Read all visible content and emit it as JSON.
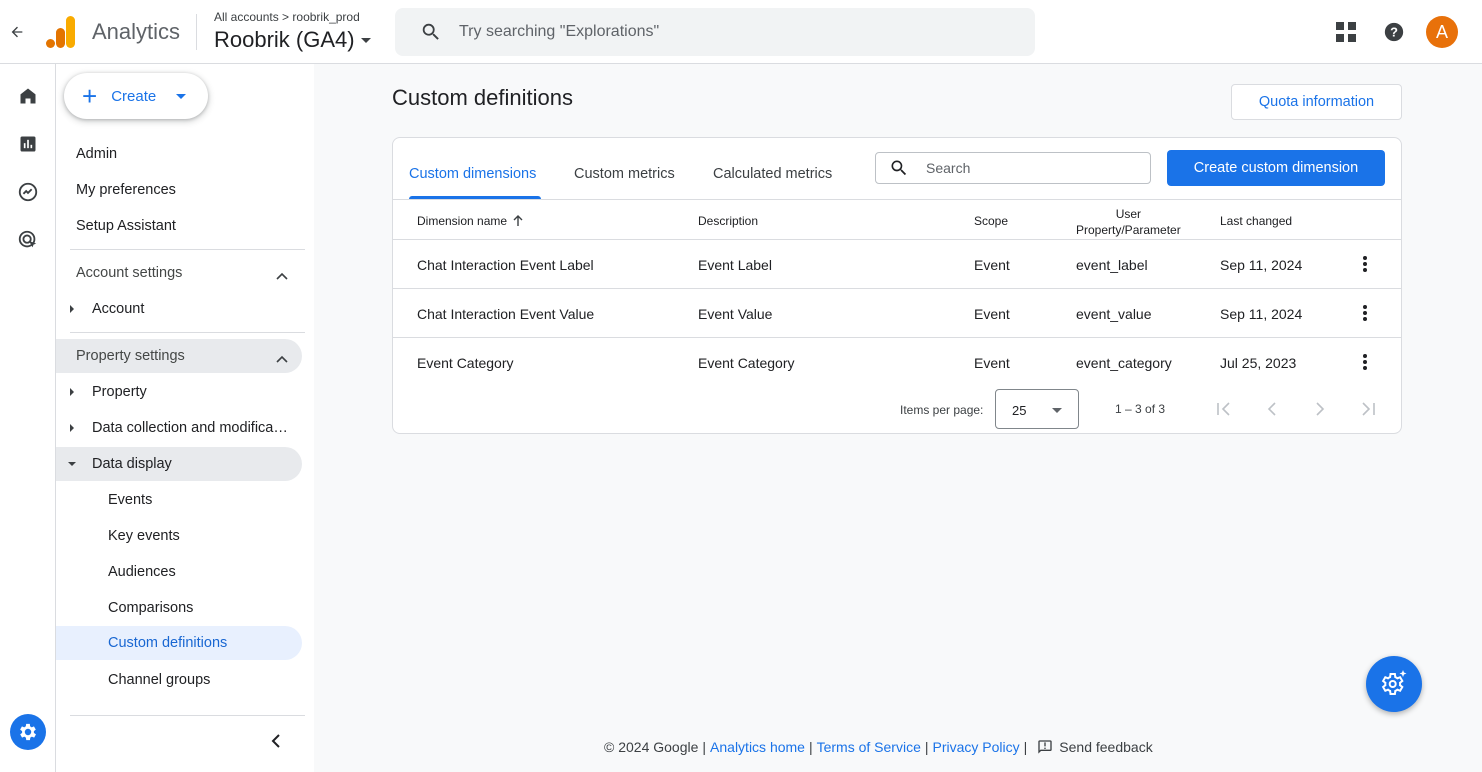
{
  "header": {
    "app_name": "Analytics",
    "breadcrumb_all": "All accounts",
    "breadcrumb_sep": ">",
    "breadcrumb_account": "roobrik_prod",
    "property_name": "Roobrik (GA4)",
    "search_placeholder": "Try searching \"Explorations\"",
    "avatar_letter": "A"
  },
  "nav": {
    "create_label": "Create",
    "top_items": [
      "Admin",
      "My preferences",
      "Setup Assistant"
    ],
    "account_settings": "Account settings",
    "account_item": "Account",
    "property_settings": "Property settings",
    "property_item": "Property",
    "data_collection_item": "Data collection and modifica…",
    "data_display_item": "Data display",
    "data_display_children": [
      "Events",
      "Key events",
      "Audiences",
      "Comparisons",
      "Custom definitions",
      "Channel groups"
    ],
    "active_item": "Custom definitions"
  },
  "main": {
    "title": "Custom definitions",
    "quota_button": "Quota information",
    "tabs": [
      "Custom dimensions",
      "Custom metrics",
      "Calculated metrics"
    ],
    "active_tab": "Custom dimensions",
    "search_placeholder": "Search",
    "create_button": "Create custom dimension",
    "columns": [
      "Dimension name",
      "Description",
      "Scope",
      "User",
      "Property/Parameter",
      "Last changed"
    ],
    "rows": [
      {
        "name": "Chat Interaction Event Label",
        "description": "Event Label",
        "scope": "Event",
        "param": "event_label",
        "changed": "Sep 11, 2024"
      },
      {
        "name": "Chat Interaction Event Value",
        "description": "Event Value",
        "scope": "Event",
        "param": "event_value",
        "changed": "Sep 11, 2024"
      },
      {
        "name": "Event Category",
        "description": "Event Category",
        "scope": "Event",
        "param": "event_category",
        "changed": "Jul 25, 2023"
      }
    ],
    "pager": {
      "items_per_page_label": "Items per page:",
      "items_per_page_value": "25",
      "range": "1 – 3 of 3"
    }
  },
  "footer": {
    "copyright": "© 2024 Google",
    "links": [
      "Analytics home",
      "Terms of Service",
      "Privacy Policy"
    ],
    "feedback": "Send feedback"
  },
  "colors": {
    "accent": "#1a73e8",
    "active_nav_bg": "#e8f0fe",
    "avatar": "#e8710a",
    "logo_orange": "#f9ab00",
    "logo_dark_orange": "#e37400"
  }
}
